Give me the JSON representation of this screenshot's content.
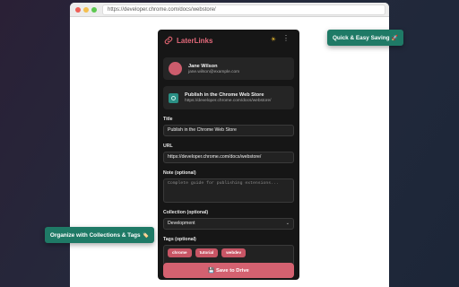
{
  "browser": {
    "url": "https://developer.chrome.com/docs/webstore/"
  },
  "popup": {
    "title": "LaterLinks",
    "theme_icon": "sun-icon",
    "menu_icon": "kebab-menu-icon",
    "user": {
      "name": "Jane Wilson",
      "email": "jane.wilson@example.com"
    },
    "page": {
      "title": "Publish in the Chrome Web Store",
      "url": "https://developer.chrome.com/docs/webstore/"
    },
    "form": {
      "title_label": "Title",
      "title_value": "Publish in the Chrome Web Store",
      "url_label": "URL",
      "url_value": "https://developer.chrome.com/docs/webstore/",
      "note_label": "Note (optional)",
      "note_placeholder": "Complete guide for publishing extensions...",
      "collection_label": "Collection (optional)",
      "collection_value": "Development",
      "tags_label": "Tags (optional)",
      "tags": [
        "chrome",
        "tutorial",
        "webdev"
      ]
    },
    "save_label": "💾 Save to Drive"
  },
  "badges": {
    "saving": "Quick & Easy Saving",
    "saving_emoji": "🚀",
    "organize": "Organize with Collections & Tags",
    "organize_emoji": "🏷️"
  },
  "colors": {
    "accent": "#e3697a",
    "button": "#d46170",
    "badge_bg": "#1f7a66",
    "popup_bg": "#161616"
  }
}
